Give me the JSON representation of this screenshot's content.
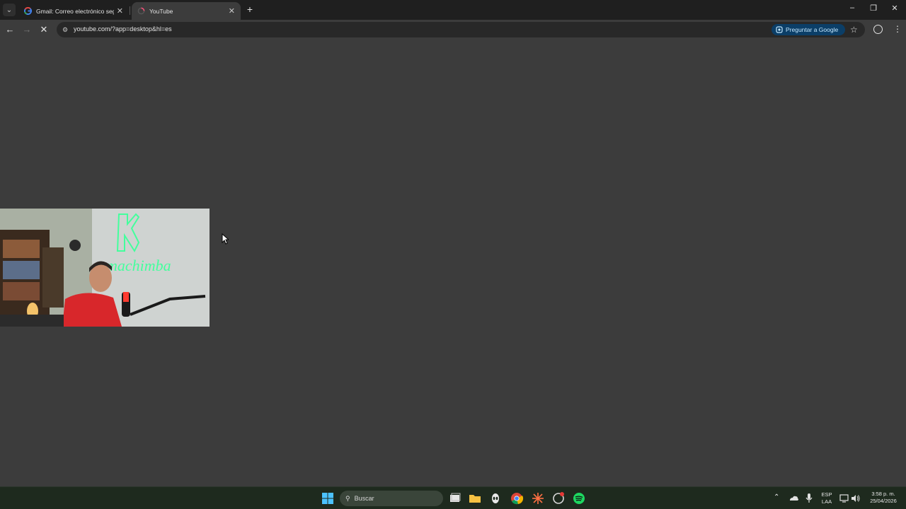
{
  "tabs": [
    {
      "title": "Gmail: Correo electrónico segu",
      "favicon": "google-icon",
      "active": false
    },
    {
      "title": "YouTube",
      "favicon": "loading-spinner-icon",
      "active": true
    }
  ],
  "address_bar": {
    "url": "youtube.com/?app=desktop&hl=es"
  },
  "ask_google_label": "Preguntar a Google",
  "taskbar": {
    "search_placeholder": "Buscar",
    "tray": {
      "lang_line1": "ESP",
      "lang_line2": "LAA",
      "time": "3:58 p. m.",
      "date": "25/04/2026"
    }
  },
  "webcam_overlay": {
    "neon_sign_text": "machimba"
  },
  "colors": {
    "accent": "#0b3e67",
    "page_bg": "#3c3c3c",
    "tabbar_bg": "#1f1f1f"
  }
}
